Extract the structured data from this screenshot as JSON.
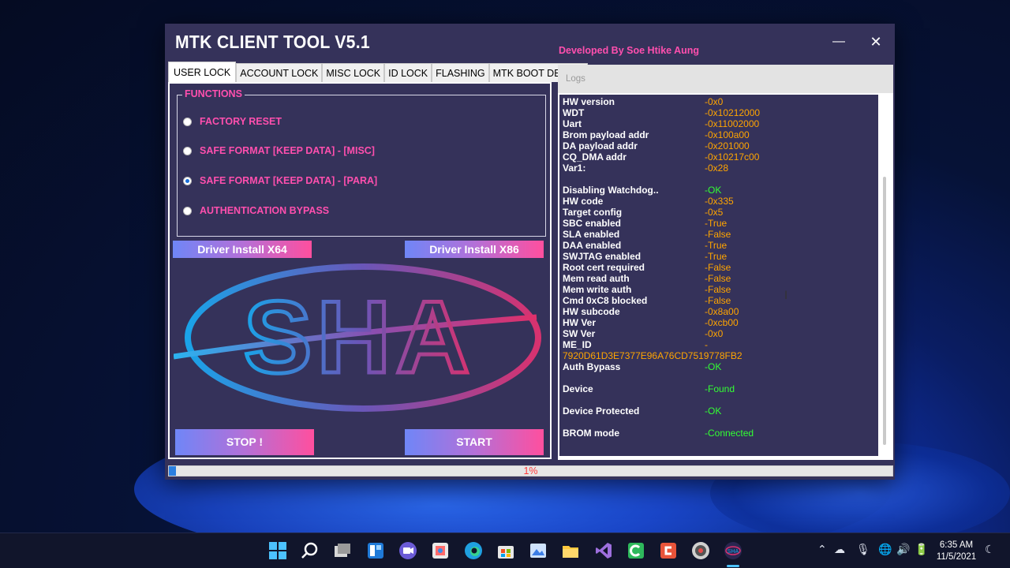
{
  "app": {
    "title": "MTK CLIENT TOOL V5.1",
    "developer": "Developed By Soe Htike Aung",
    "min_glyph": "—",
    "close_glyph": "✕"
  },
  "tabs": [
    {
      "label": "USER LOCK",
      "active": true
    },
    {
      "label": "ACCOUNT LOCK"
    },
    {
      "label": "MISC LOCK"
    },
    {
      "label": "ID LOCK"
    },
    {
      "label": "FLASHING"
    },
    {
      "label": "MTK BOOT DEVICE"
    }
  ],
  "functions": {
    "legend": "FUNCTIONS",
    "options": [
      {
        "label": "FACTORY RESET",
        "selected": false
      },
      {
        "label": "SAFE FORMAT [KEEP DATA] - [MISC]",
        "selected": false
      },
      {
        "label": "SAFE FORMAT [KEEP DATA] - [PARA]",
        "selected": true
      },
      {
        "label": "AUTHENTICATION BYPASS",
        "selected": false
      }
    ]
  },
  "buttons": {
    "driver_x64": "Driver Install X64",
    "driver_x86": "Driver Install X86",
    "stop": "STOP !",
    "start": "START"
  },
  "logo": {
    "text": "SHA"
  },
  "logs": {
    "title": "Logs",
    "lines": [
      {
        "key": "HW version",
        "value": "-0x0",
        "color": "orange"
      },
      {
        "key": "WDT",
        "value": "-0x10212000",
        "color": "orange"
      },
      {
        "key": "Uart",
        "value": "-0x11002000",
        "color": "orange"
      },
      {
        "key": "Brom payload addr",
        "value": "-0x100a00",
        "color": "orange"
      },
      {
        "key": "DA payload addr",
        "value": "-0x201000",
        "color": "orange"
      },
      {
        "key": "CQ_DMA addr",
        "value": "-0x10217c00",
        "color": "orange"
      },
      {
        "key": "Var1:",
        "value": "-0x28",
        "color": "orange"
      },
      {
        "key": "Disabling Watchdog..",
        "value": "-OK",
        "color": "green"
      },
      {
        "key": "HW code",
        "value": "-0x335",
        "color": "orange"
      },
      {
        "key": "Target config",
        "value": "-0x5",
        "color": "orange"
      },
      {
        "key": "SBC enabled",
        "value": "-True",
        "color": "orange"
      },
      {
        "key": "SLA enabled",
        "value": "-False",
        "color": "orange"
      },
      {
        "key": "DAA enabled",
        "value": "-True",
        "color": "orange"
      },
      {
        "key": "SWJTAG enabled",
        "value": "-True",
        "color": "orange"
      },
      {
        "key": "Root cert required",
        "value": "-False",
        "color": "orange"
      },
      {
        "key": "Mem read auth",
        "value": "-False",
        "color": "orange"
      },
      {
        "key": "Mem write auth",
        "value": "-False",
        "color": "orange"
      },
      {
        "key": "Cmd 0xC8 blocked",
        "value": "-False",
        "color": "orange"
      },
      {
        "key": "HW subcode",
        "value": "-0x8a00",
        "color": "orange"
      },
      {
        "key": "HW Ver",
        "value": "-0xcb00",
        "color": "orange"
      },
      {
        "key": "SW Ver",
        "value": "-0x0",
        "color": "orange"
      },
      {
        "key": "ME_ID",
        "value": "-",
        "color": "orange"
      },
      {
        "key": "Auth Bypass",
        "value": "-OK",
        "color": "green"
      },
      {
        "key": "Device",
        "value": "-Found",
        "color": "green"
      },
      {
        "key": "Device Protected",
        "value": "-OK",
        "color": "green"
      },
      {
        "key": "BROM mode",
        "value": "-Connected",
        "color": "green"
      }
    ],
    "me_id_value": "7920D61D3E7377E96A76CD7519778FB2"
  },
  "progress": {
    "percent": 1,
    "label": "1%"
  },
  "colors": {
    "accent_pink": "#ff4fae",
    "value_orange": "#ffa500",
    "value_green": "#33ff33",
    "panel_bg": "#35325a",
    "progress_blue": "#2b7fe0"
  },
  "taskbar": {
    "icons": [
      "windows-start-icon",
      "search-icon",
      "task-view-icon",
      "widgets-icon",
      "chat-icon",
      "snipping-tool-icon",
      "edge-icon",
      "store-icon",
      "photos-icon",
      "file-explorer-icon",
      "visual-studio-icon",
      "camtasia-icon",
      "toolbox-icon",
      "media-player-icon",
      "mtk-client-icon"
    ],
    "clock_time": "6:35 AM",
    "clock_date": "11/5/2021"
  }
}
